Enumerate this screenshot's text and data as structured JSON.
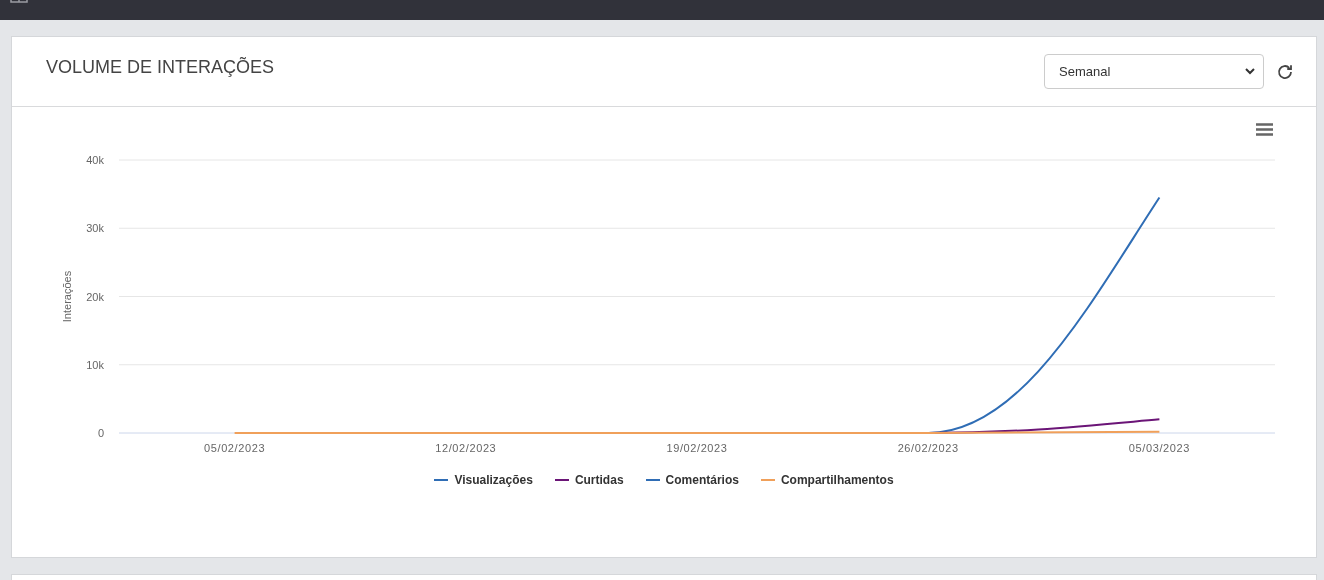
{
  "panel": {
    "title": "VOLUME DE INTERAÇÕES",
    "period_select": {
      "value": "Semanal"
    },
    "chart_data": {
      "type": "line",
      "ylabel": "Interações",
      "categories": [
        "05/02/2023",
        "12/02/2023",
        "19/02/2023",
        "26/02/2023",
        "05/03/2023"
      ],
      "ylim": [
        0,
        40000
      ],
      "grid": true,
      "yticks": [
        {
          "value": 0,
          "label": "0"
        },
        {
          "value": 10000,
          "label": "10k"
        },
        {
          "value": 20000,
          "label": "20k"
        },
        {
          "value": 30000,
          "label": "30k"
        },
        {
          "value": 40000,
          "label": "40k"
        }
      ],
      "series": [
        {
          "name": "Visualizações",
          "color": "#2f6db5",
          "values": [
            null,
            null,
            null,
            0,
            34500
          ]
        },
        {
          "name": "Curtidas",
          "color": "#6b1577",
          "values": [
            null,
            null,
            null,
            0,
            2000
          ]
        },
        {
          "name": "Comentários",
          "color": "#2f6db5",
          "values": [
            null,
            null,
            null,
            null,
            null
          ]
        },
        {
          "name": "Compartilhamentos",
          "color": "#f0a05a",
          "values": [
            0,
            0,
            0,
            0,
            200
          ]
        }
      ]
    }
  }
}
